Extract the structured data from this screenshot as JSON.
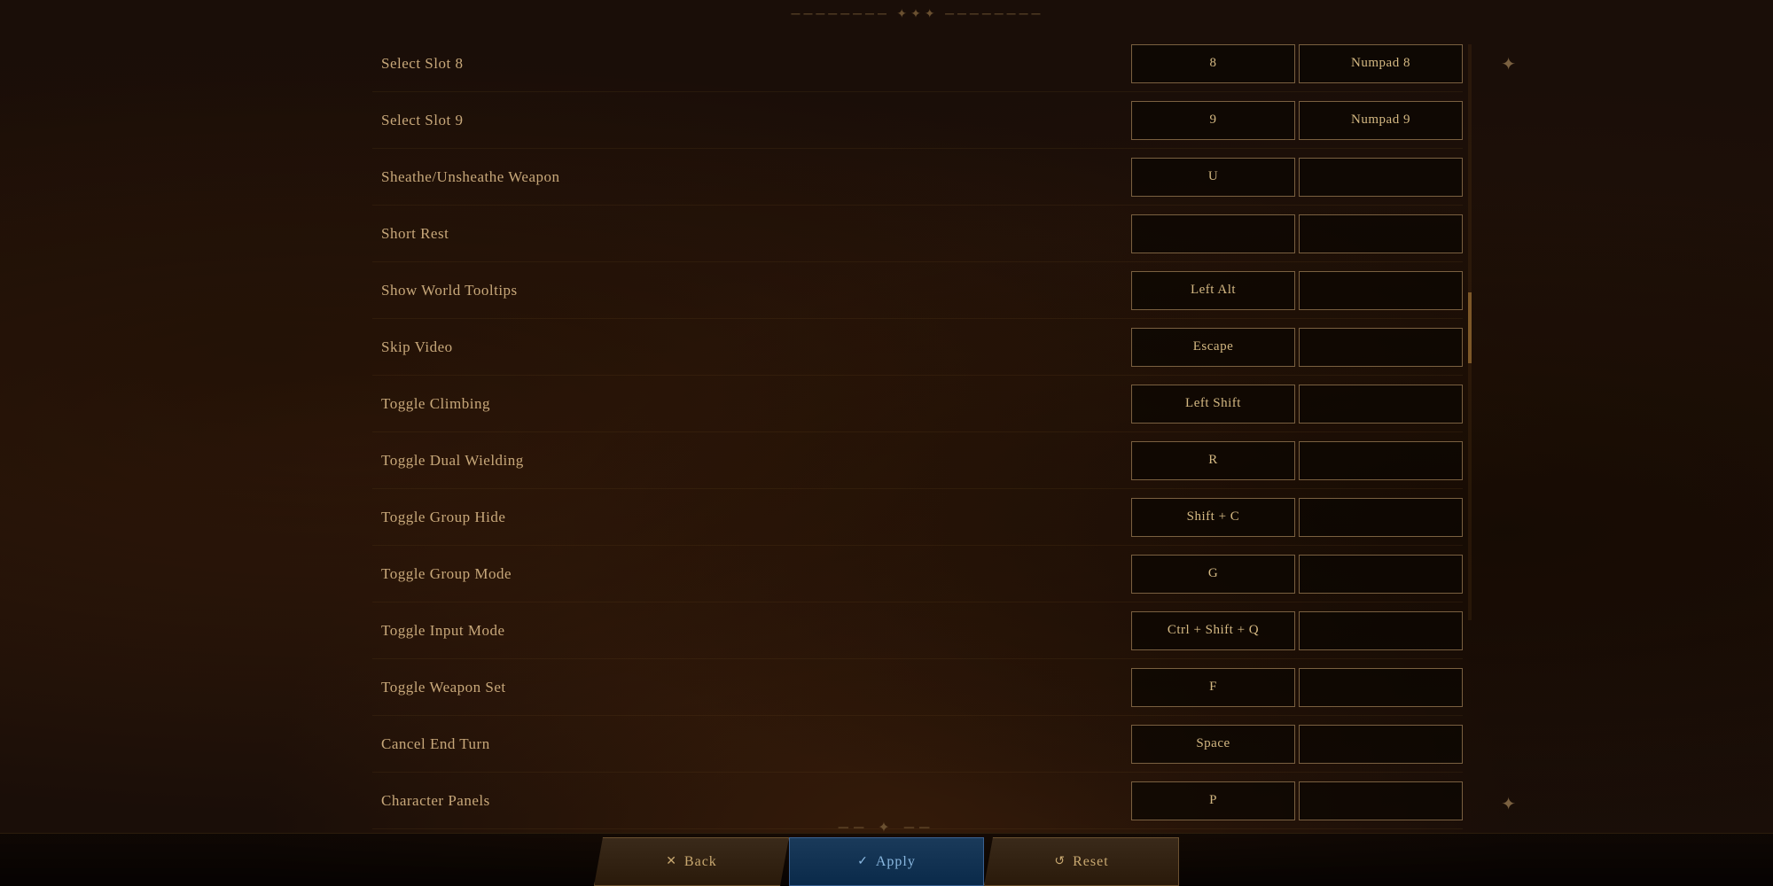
{
  "ornament_top": "✦ ─────────────── ✦ ─────────────── ✦",
  "ornament_bottom": "✦ ─────────────── ✦ ─────────────── ✦",
  "keybinds": [
    {
      "action": "Select Slot 8",
      "primary": "8",
      "secondary": "Numpad 8"
    },
    {
      "action": "Select Slot 9",
      "primary": "9",
      "secondary": "Numpad 9"
    },
    {
      "action": "Sheathe/Unsheathe Weapon",
      "primary": "U",
      "secondary": ""
    },
    {
      "action": "Short Rest",
      "primary": "",
      "secondary": ""
    },
    {
      "action": "Show World Tooltips",
      "primary": "Left Alt",
      "secondary": ""
    },
    {
      "action": "Skip Video",
      "primary": "Escape",
      "secondary": ""
    },
    {
      "action": "Toggle Climbing",
      "primary": "Left Shift",
      "secondary": ""
    },
    {
      "action": "Toggle Dual Wielding",
      "primary": "R",
      "secondary": ""
    },
    {
      "action": "Toggle Group Hide",
      "primary": "Shift + C",
      "secondary": ""
    },
    {
      "action": "Toggle Group Mode",
      "primary": "G",
      "secondary": ""
    },
    {
      "action": "Toggle Input Mode",
      "primary": "Ctrl + Shift + Q",
      "secondary": ""
    },
    {
      "action": "Toggle Weapon Set",
      "primary": "F",
      "secondary": ""
    },
    {
      "action": "Cancel End Turn",
      "primary": "Space",
      "secondary": ""
    },
    {
      "action": "Character Panels",
      "primary": "P",
      "secondary": ""
    }
  ],
  "buttons": {
    "back": "Back",
    "apply": "Apply",
    "reset": "Reset",
    "back_icon": "✕",
    "apply_icon": "✓",
    "reset_icon": "↺"
  }
}
